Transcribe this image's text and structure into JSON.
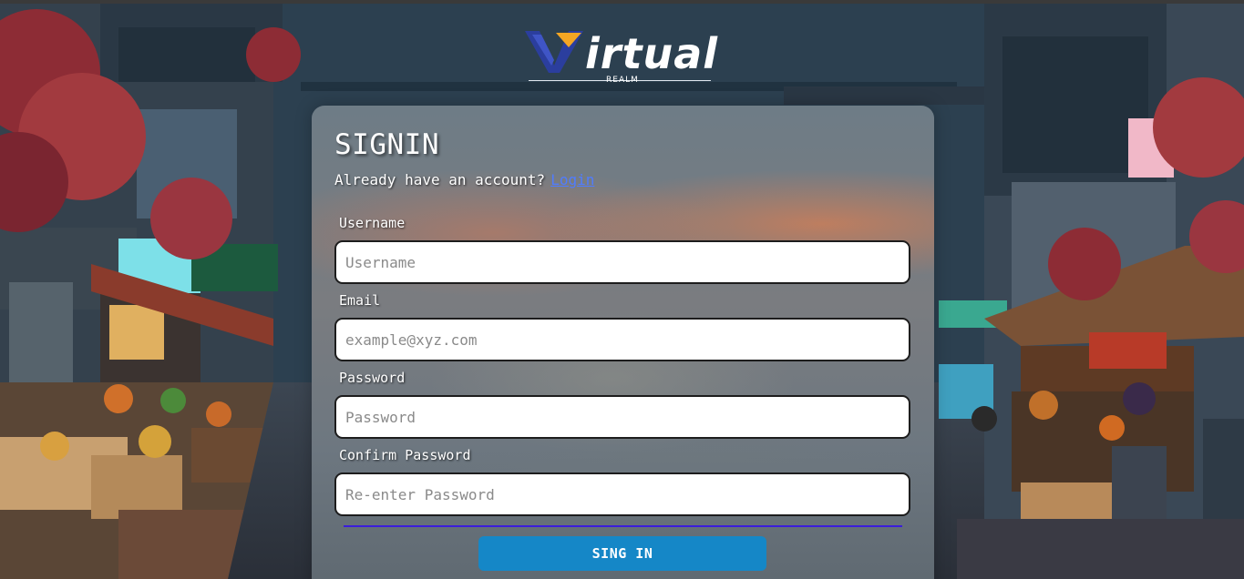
{
  "logo": {
    "wordmark": "irtual",
    "subtitle": "REALM",
    "mark_colors": {
      "v": "#2b3e9e",
      "accent": "#f5a623"
    }
  },
  "form": {
    "title": "SIGNIN",
    "subtitle_text": "Already have an account?",
    "login_link": "Login",
    "fields": [
      {
        "label": "Username",
        "placeholder": "Username",
        "value": ""
      },
      {
        "label": "Email",
        "placeholder": "example@xyz.com",
        "value": ""
      },
      {
        "label": "Password",
        "placeholder": "Password",
        "value": ""
      },
      {
        "label": "Confirm Password",
        "placeholder": "Re-enter Password",
        "value": ""
      }
    ],
    "submit_label": "SING IN"
  },
  "colors": {
    "button": "#1587c7",
    "link": "#4f7cff",
    "divider": "#3b1ddb"
  }
}
